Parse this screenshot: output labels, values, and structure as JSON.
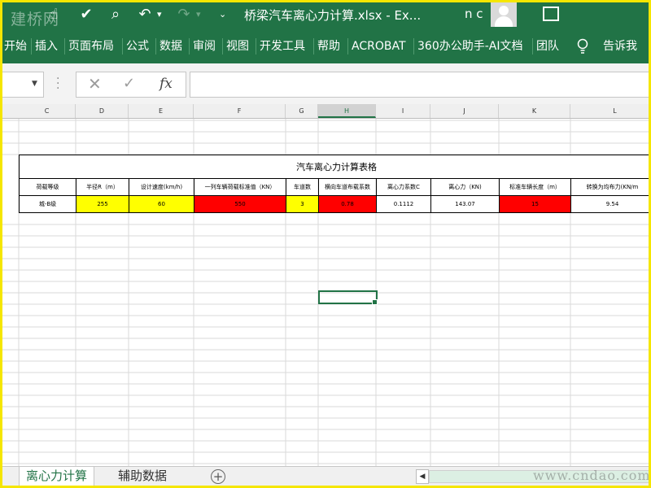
{
  "window": {
    "title": "桥梁汽车离心力计算.xlsx  -  Ex...",
    "user": "n c",
    "watermark_top": "建桥网",
    "watermark_bottom": "www.cndao.com"
  },
  "ribbon": {
    "tabs": [
      "开始",
      "插入",
      "页面布局",
      "公式",
      "数据",
      "审阅",
      "视图",
      "开发工具",
      "帮助",
      "ACROBAT",
      "360办公助手-AI文档",
      "团队"
    ],
    "tell_me": "告诉我"
  },
  "formula_bar": {
    "name_box": "",
    "formula": ""
  },
  "columns": [
    "C",
    "D",
    "E",
    "F",
    "G",
    "H",
    "I",
    "J",
    "K",
    "L"
  ],
  "table": {
    "title": "汽车离心力计算表格",
    "headers": [
      "荷载等级",
      "半径R（m）",
      "设计速度(km/h)",
      "一列车辆荷载标准值（KN）",
      "车道数",
      "横向车道布载系数",
      "离心力系数C",
      "离心力（KN)",
      "标准车辆长度（m）",
      "转换为均布力(KN/m"
    ],
    "values": [
      "城-B级",
      "255",
      "60",
      "550",
      "3",
      "0.78",
      "0.1112",
      "143.07",
      "15",
      "9.54"
    ]
  },
  "sheets": {
    "active": "离心力计算",
    "other": "辅助数据"
  },
  "colors": {
    "excel_green": "#217346",
    "input_yellow": "#ffff00",
    "input_red": "#ff0000",
    "frame_yellow": "#f5e600"
  }
}
